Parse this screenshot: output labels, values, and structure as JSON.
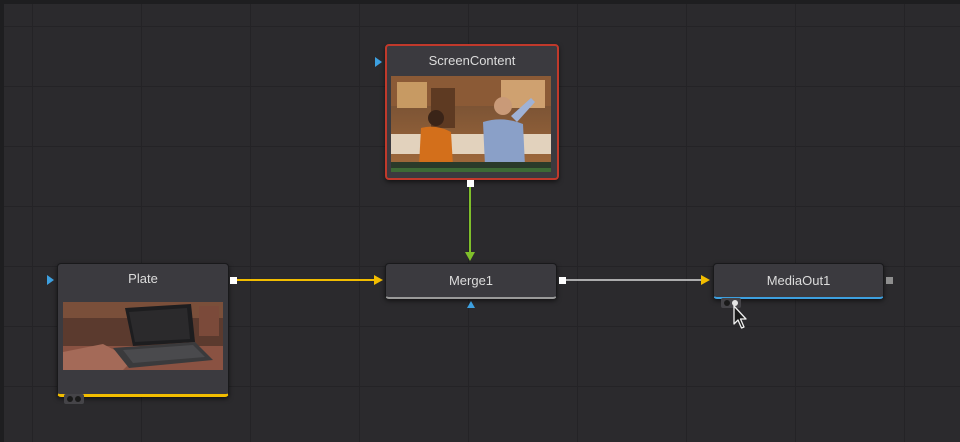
{
  "flow": {
    "nodes": {
      "screen_content": {
        "title": "ScreenContent",
        "selected": true
      },
      "plate": {
        "title": "Plate"
      },
      "merge": {
        "title": "Merge1"
      },
      "media_out": {
        "title": "MediaOut1"
      }
    },
    "connections": [
      {
        "from": "ScreenContent",
        "to": "Merge1",
        "input": "foreground",
        "color": "#7fbf2a"
      },
      {
        "from": "Plate",
        "to": "Merge1",
        "input": "background",
        "color": "#f2bd00"
      },
      {
        "from": "Merge1",
        "to": "MediaOut1",
        "input": "input",
        "color": "#d8d8d8"
      }
    ]
  },
  "colors": {
    "canvas": "#2b2a2d",
    "node_body": "#3b3a3f",
    "selected_outline": "#c0392b",
    "background_input": "#f2bd00",
    "foreground_input": "#7fbf2a",
    "mask_input": "#3da0e0",
    "output_port": "#ffffff"
  },
  "icons": {
    "cursor": "mouse-pointer-icon",
    "view_indicator": "viewer-dots-icon"
  }
}
